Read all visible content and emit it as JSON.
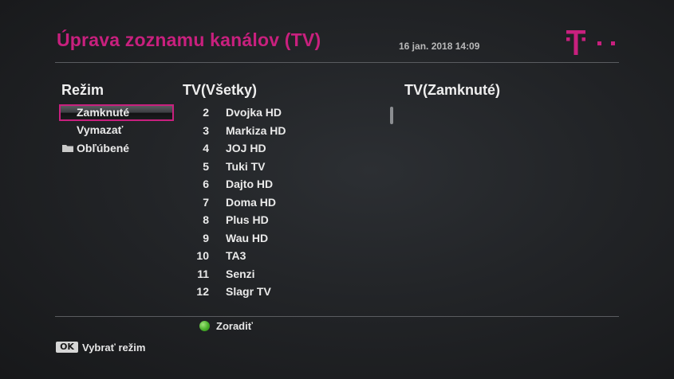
{
  "header": {
    "title": "Úprava zoznamu kanálov (TV)",
    "datetime": "16 jan. 2018 14:09"
  },
  "colors": {
    "brand": "#c8207e",
    "accent_ok": "#49b02a"
  },
  "mode_panel": {
    "heading": "Režim",
    "items": [
      {
        "label": "Zamknuté",
        "selected": true,
        "icon": ""
      },
      {
        "label": "Vymazať",
        "selected": false,
        "icon": ""
      },
      {
        "label": "Obľúbené",
        "selected": false,
        "icon": "folder-icon"
      }
    ]
  },
  "channel_panel": {
    "heading": "TV(Všetky)",
    "channels": [
      {
        "number": "2",
        "name": "Dvojka HD"
      },
      {
        "number": "3",
        "name": "Markiza HD"
      },
      {
        "number": "4",
        "name": "JOJ HD"
      },
      {
        "number": "5",
        "name": "Tuki TV"
      },
      {
        "number": "6",
        "name": "Dajto HD"
      },
      {
        "number": "7",
        "name": "Doma HD"
      },
      {
        "number": "8",
        "name": "Plus HD"
      },
      {
        "number": "9",
        "name": "Wau HD"
      },
      {
        "number": "10",
        "name": "TA3"
      },
      {
        "number": "11",
        "name": "Senzi"
      },
      {
        "number": "12",
        "name": "Slagr TV"
      }
    ]
  },
  "locked_panel": {
    "heading": "TV(Zamknuté)"
  },
  "footer": {
    "green_action": "Zoradiť",
    "ok_key": "OK",
    "ok_action": "Vybrať režim"
  }
}
